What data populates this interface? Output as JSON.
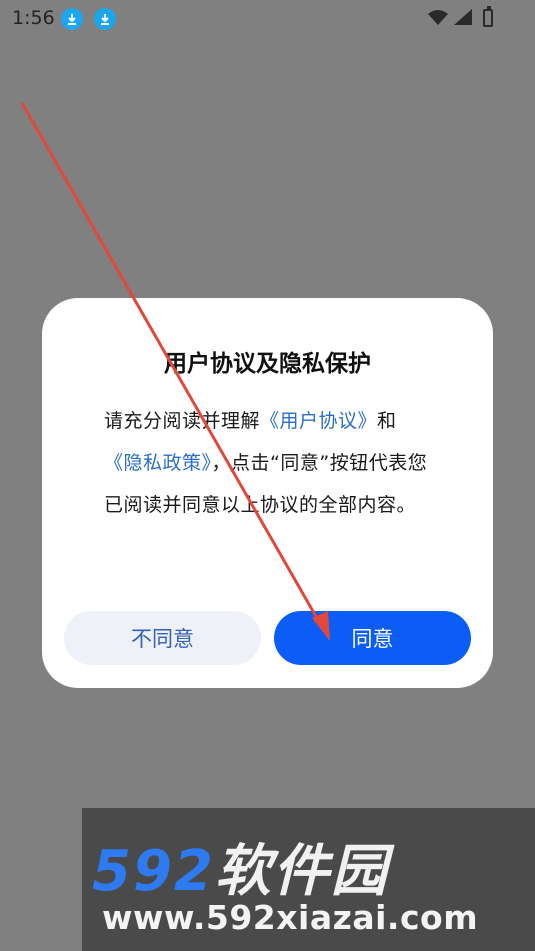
{
  "status_bar": {
    "time": "1:56",
    "download_icon_1": "download-icon",
    "download_icon_2": "download-icon",
    "wifi_icon": "wifi-icon",
    "signal_icon": "signal-icon",
    "battery_icon": "battery-charging-icon"
  },
  "dialog": {
    "title": "用户协议及隐私保护",
    "body_prefix": "请充分阅读并理解",
    "link_user_agreement": "《用户协议》",
    "body_and": "和",
    "link_privacy_policy": "《隐私政策》",
    "body_suffix": "，点击“同意”按钮代表您已阅读并同意以上协议的全部内容。",
    "disagree_label": "不同意",
    "agree_label": "同意"
  },
  "watermark": {
    "brand_num": "592",
    "brand_cn": "软件园",
    "url": "www.592xiazai.com"
  },
  "colors": {
    "overlay": "#808080",
    "accent_blue": "#0b5df5",
    "link_blue": "#2a6ec8",
    "arrow_red": "#e2483a"
  }
}
